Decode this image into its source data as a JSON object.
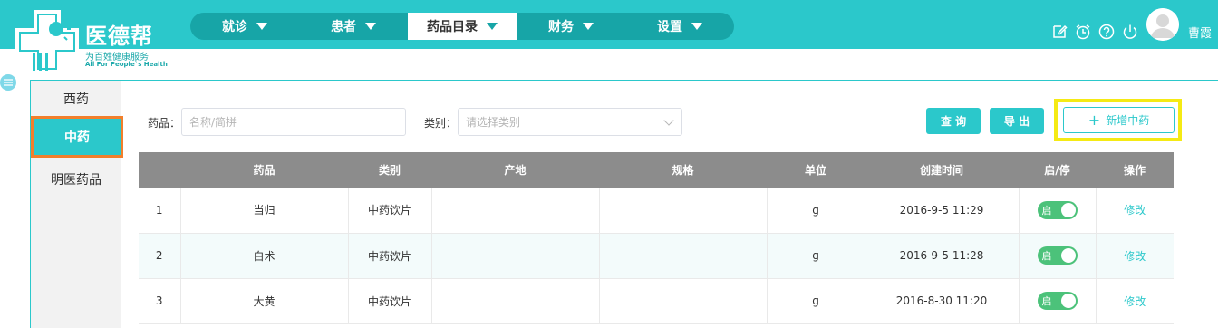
{
  "brand": {
    "name": "医德帮",
    "slogan": "为百姓健康服务",
    "slogan_en": "All For People`s Health"
  },
  "nav": {
    "items": [
      {
        "label": "就诊"
      },
      {
        "label": "患者"
      },
      {
        "label": "药品目录"
      },
      {
        "label": "财务"
      },
      {
        "label": "设置"
      }
    ],
    "active": "药品目录"
  },
  "header": {
    "icons": [
      "edit-icon",
      "alarm-icon",
      "help-icon",
      "power-icon"
    ],
    "user_name": "曹霞"
  },
  "sidebar": {
    "items": [
      {
        "label": "西药"
      },
      {
        "label": "中药"
      },
      {
        "label": "明医药品"
      }
    ],
    "active": "中药"
  },
  "filters": {
    "drug_label": "药品：",
    "drug_placeholder": "名称/简拼",
    "category_label": "类别：",
    "category_placeholder": "请选择类别"
  },
  "actions": {
    "query": "查 询",
    "export": "导 出",
    "add": "新增中药"
  },
  "table": {
    "headers": [
      "",
      "药品",
      "类别",
      "产地",
      "规格",
      "单位",
      "创建时间",
      "启/停",
      "操作"
    ],
    "rows": [
      {
        "index": "1",
        "name": "当归",
        "category": "中药饮片",
        "origin": "",
        "spec": "",
        "unit": "g",
        "created": "2016-9-5 11:29",
        "status": "启",
        "action": "修改"
      },
      {
        "index": "2",
        "name": "白术",
        "category": "中药饮片",
        "origin": "",
        "spec": "",
        "unit": "g",
        "created": "2016-9-5 11:28",
        "status": "启",
        "action": "修改"
      },
      {
        "index": "3",
        "name": "大黄",
        "category": "中药饮片",
        "origin": "",
        "spec": "",
        "unit": "g",
        "created": "2016-8-30 11:20",
        "status": "启",
        "action": "修改"
      }
    ]
  },
  "colors": {
    "primary": "#2bc8cb",
    "nav_dark": "#17a5a7",
    "highlight_yellow": "#f5ea14",
    "highlight_orange": "#f27f2b",
    "toggle_on": "#4cc27a",
    "table_header": "#8c8c8c"
  }
}
